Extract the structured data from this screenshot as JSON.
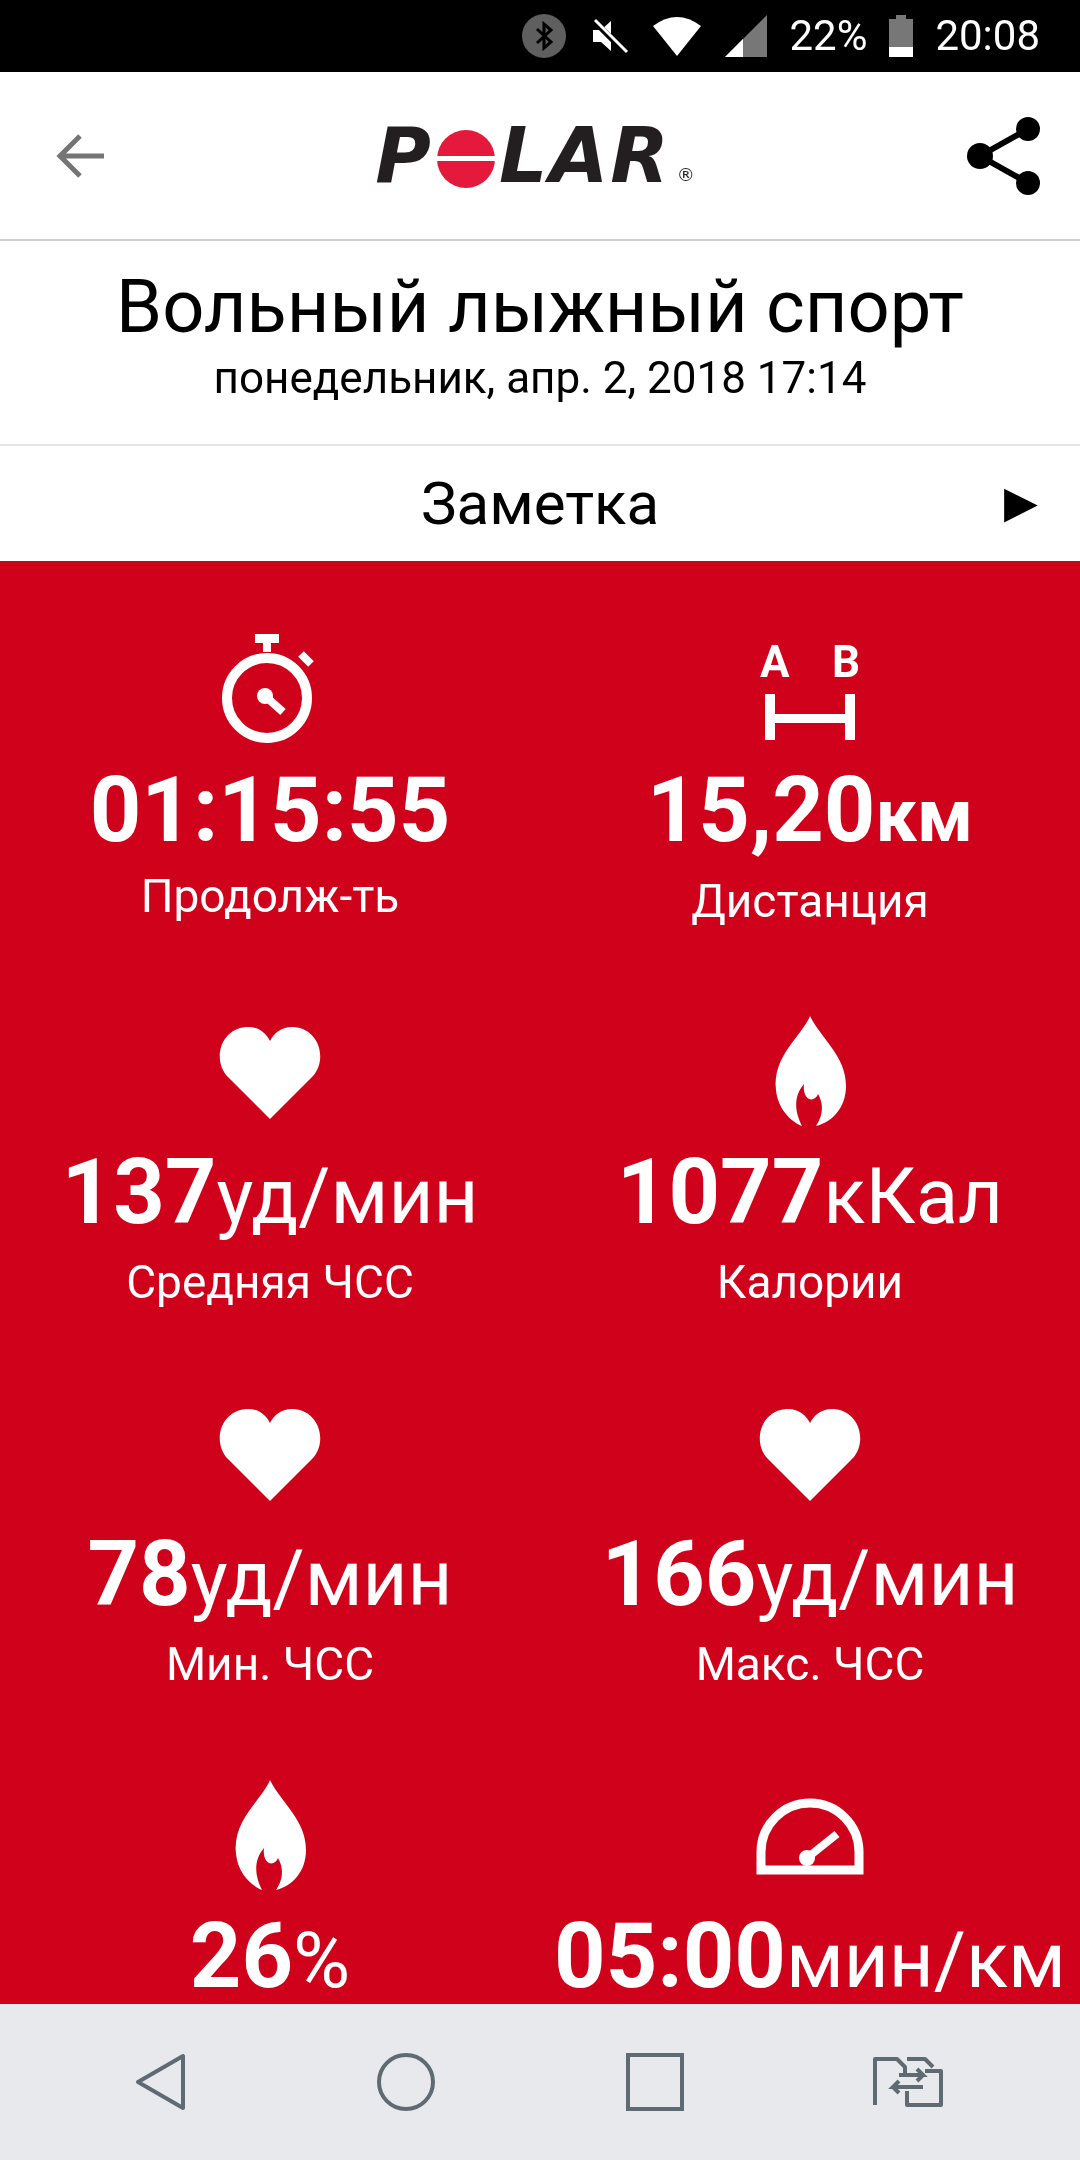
{
  "status_bar": {
    "battery_text": "22%",
    "time": "20:08"
  },
  "header": {
    "logo": {
      "before": "P",
      "after": "LAR",
      "mark": "®"
    }
  },
  "workout": {
    "title": "Вольный лыжный спорт",
    "date": "понедельник, апр. 2, 2018 17:14"
  },
  "note": {
    "label": "Заметка",
    "arrow": "▶"
  },
  "distance_icon": {
    "letters": [
      "A",
      "B"
    ]
  },
  "stats": [
    {
      "kind": "stopwatch",
      "value": "01:15:55",
      "label": "Продолж-ть"
    },
    {
      "kind": "distance",
      "value": "15,20",
      "unit": "км",
      "label": "Дистанция"
    },
    {
      "kind": "heart",
      "value": "137",
      "unit": "уд/мин",
      "label": "Средняя ЧСС"
    },
    {
      "kind": "flame",
      "value": "1077",
      "unit": "кКал",
      "label": "Калории"
    },
    {
      "kind": "heart",
      "value": "78",
      "unit": "уд/мин",
      "label": "Мин. ЧСС"
    },
    {
      "kind": "heart",
      "value": "166",
      "unit": "уд/мин",
      "label": "Макс. ЧСС"
    },
    {
      "kind": "flame",
      "value": "26",
      "unit": "%"
    },
    {
      "kind": "speedometer",
      "value": "05:00",
      "unit": "мин/км"
    }
  ]
}
